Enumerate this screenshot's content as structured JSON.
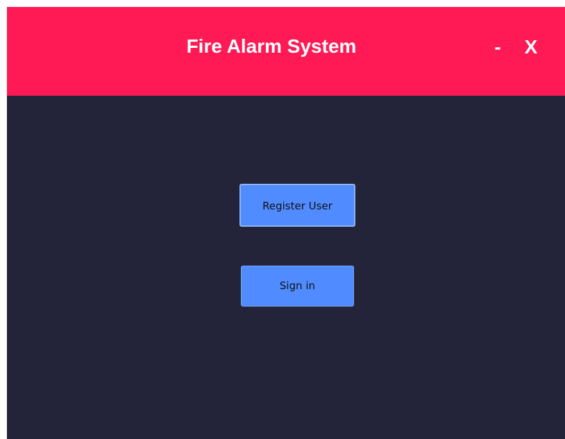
{
  "window": {
    "title": "Fire Alarm System",
    "minimize_label": "-",
    "close_label": "X"
  },
  "actions": {
    "register_label": "Register User",
    "signin_label": "Sign in"
  },
  "colors": {
    "titlebar": "#ff1a55",
    "background": "#23233a",
    "button": "#508cff"
  }
}
